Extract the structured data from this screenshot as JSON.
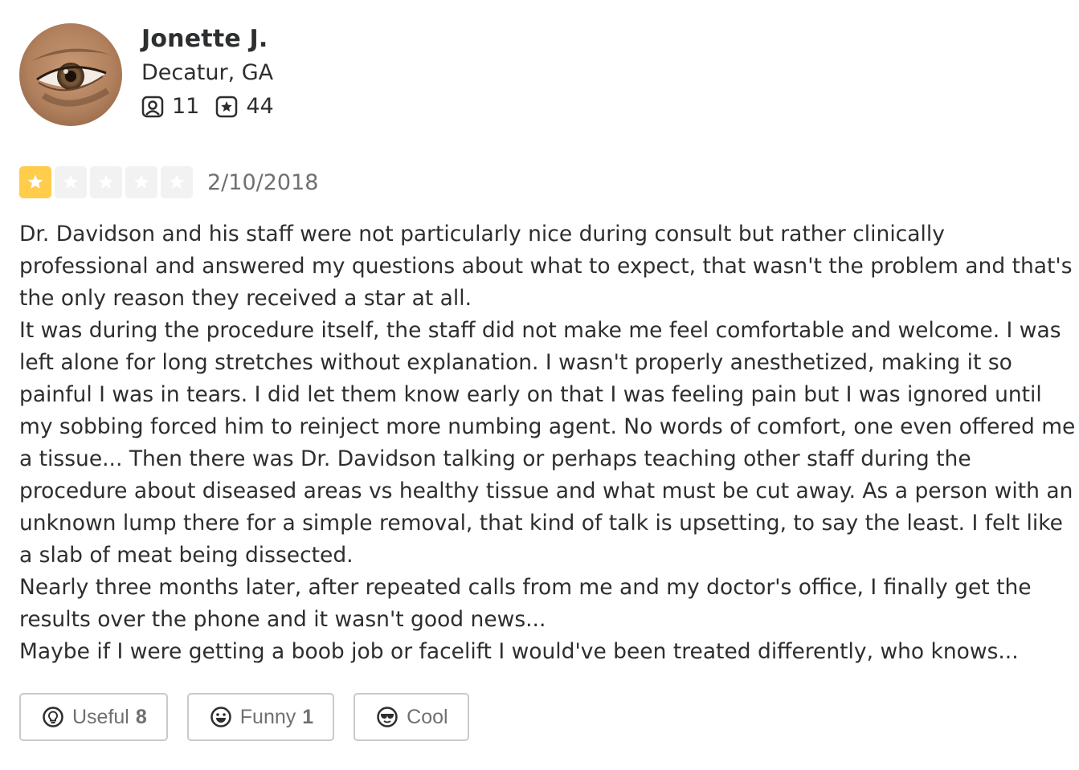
{
  "user": {
    "name": "Jonette J.",
    "location": "Decatur, GA",
    "friends_count": "11",
    "reviews_count": "44",
    "avatar_icon": "profile-photo-eye",
    "friends_icon": "friends-icon",
    "reviews_icon": "reviews-star-icon"
  },
  "review": {
    "rating": 1,
    "max_rating": 5,
    "date": "2/10/2018",
    "paragraphs": [
      "Dr. Davidson and his staff were not particularly nice during consult but rather clinically professional and answered my questions about what to expect, that wasn't the problem and that's the only reason they received a star at all.",
      "It was during the procedure itself, the staff did not make me feel comfortable and welcome. I was left alone for long stretches without explanation. I wasn't properly anesthetized, making it so painful I was in tears. I did let them know early on that I was feeling pain but I was ignored until my sobbing forced him to reinject more numbing agent. No words of comfort, one even offered me a tissue... Then there was Dr. Davidson talking or perhaps teaching other staff during the procedure about diseased areas vs healthy tissue and what must be cut away. As a person with an unknown lump there for a simple removal, that kind of talk is upsetting, to say the least. I felt like a slab of meat being dissected.",
      "Nearly three months later, after repeated calls from me and my doctor's office, I finally get the results over the phone and it wasn't good news...",
      "Maybe if I were getting a boob job or facelift I would've been treated differently, who knows..."
    ]
  },
  "actions": {
    "useful_label": "Useful",
    "useful_count": "8",
    "funny_label": "Funny",
    "funny_count": "1",
    "cool_label": "Cool"
  },
  "colors": {
    "star_filled": "#ffcc4b",
    "star_empty": "#f2f2f2",
    "text": "#2d2e2f",
    "muted": "#6e7072",
    "button_border": "#c8c9ca"
  }
}
